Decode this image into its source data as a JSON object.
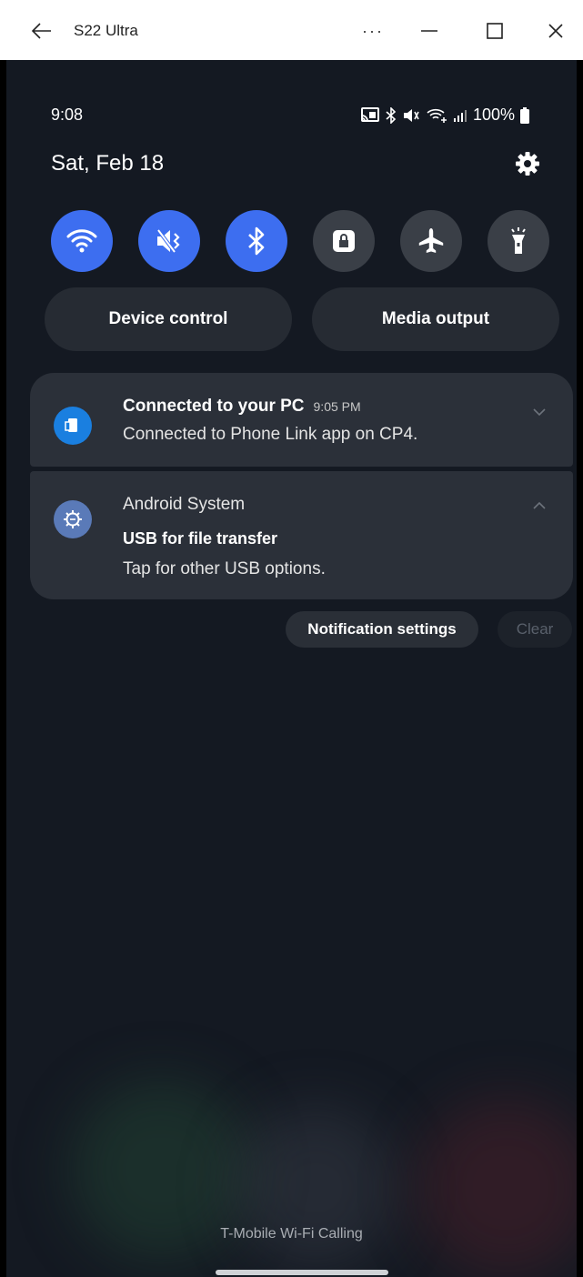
{
  "window": {
    "title": "S22 Ultra",
    "more_label": "···"
  },
  "status_bar": {
    "time": "9:08",
    "battery": "100%"
  },
  "header": {
    "date": "Sat, Feb 18"
  },
  "quick_settings": [
    {
      "icon": "wifi-icon",
      "state": "on"
    },
    {
      "icon": "mute-icon",
      "state": "on"
    },
    {
      "icon": "bluetooth-icon",
      "state": "on"
    },
    {
      "icon": "lock-icon",
      "state": "off"
    },
    {
      "icon": "airplane-icon",
      "state": "off"
    },
    {
      "icon": "flashlight-icon",
      "state": "off"
    }
  ],
  "pills": {
    "device_control": "Device control",
    "media_output": "Media output"
  },
  "notifications": [
    {
      "title": "Connected to your PC",
      "time": "9:05 PM",
      "text": "Connected to Phone Link app on CP4."
    },
    {
      "title": "Android System",
      "subtitle": "USB for file transfer",
      "text": "Tap for other USB options."
    }
  ],
  "actions": {
    "notification_settings": "Notification settings",
    "clear": "Clear"
  },
  "footer": {
    "carrier": "T-Mobile Wi-Fi Calling"
  },
  "colors": {
    "accent": "#3d6ef0",
    "background": "#141922",
    "card": "#2b3039"
  }
}
